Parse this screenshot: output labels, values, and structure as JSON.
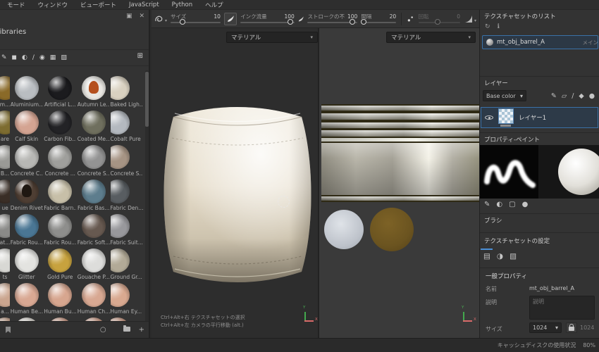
{
  "menubar": {
    "items": [
      {
        "label": "モード"
      },
      {
        "label": "ウィンドウ"
      },
      {
        "label": "ビューポート"
      },
      {
        "label": "JavaScript"
      },
      {
        "label": "Python"
      },
      {
        "label": "ヘルプ"
      }
    ]
  },
  "toolbar": {
    "size": {
      "label": "サイズ",
      "value": "10"
    },
    "flow": {
      "label": "インク流量",
      "value": "100"
    },
    "opacity": {
      "label": "ストロークの不",
      "value": "100"
    },
    "spacing": {
      "label": "間隔",
      "value": "20"
    },
    "rotation": {
      "label": "回転",
      "value": "0"
    }
  },
  "library": {
    "title": "Libraries",
    "filters": [
      {
        "name": "brush-filter-icon",
        "glyph": "✎"
      },
      {
        "name": "material-filter-icon",
        "glyph": "◼"
      },
      {
        "name": "smart-material-filter-icon",
        "glyph": "◐"
      },
      {
        "name": "pencil-filter-icon",
        "glyph": "∕"
      },
      {
        "name": "alpha-filter-icon",
        "glyph": "◉"
      },
      {
        "name": "pattern-filter-icon",
        "glyph": "▦"
      },
      {
        "name": "texture-filter-icon",
        "glyph": "▨"
      }
    ],
    "items": [
      {
        "name": "m...",
        "c": "#8a6a28"
      },
      {
        "name": "Aluminium...",
        "c": "#b9bdc1"
      },
      {
        "name": "Artificial L...",
        "c": "#1b1b1e"
      },
      {
        "name": "Autumn Le...",
        "c": "#e9e7e2",
        "accent": "#b5501e"
      },
      {
        "name": "Baked Ligh...",
        "c": "#d9d1c0"
      },
      {
        "name": "are",
        "c": "#7d6c30"
      },
      {
        "name": "Calf Skin",
        "c": "#d4a492"
      },
      {
        "name": "Carbon Fib...",
        "c": "#232326"
      },
      {
        "name": "Coated Me...",
        "c": "#6f6f5e"
      },
      {
        "name": "Cobalt Pure",
        "c": "#b4b9bf"
      },
      {
        "name": "B...",
        "c": "#9a9a96"
      },
      {
        "name": "Concrete C...",
        "c": "#b7b7b4"
      },
      {
        "name": "Concrete ...",
        "c": "#9f9f9c"
      },
      {
        "name": "Concrete S...",
        "c": "#939393"
      },
      {
        "name": "Concrete S...",
        "c": "#a69484"
      },
      {
        "name": "ue",
        "c": "#3a2e26"
      },
      {
        "name": "Denim Rivet",
        "c": "#4e3e33",
        "accent": "#1f1812"
      },
      {
        "name": "Fabric Barn...",
        "c": "#c7bfa8"
      },
      {
        "name": "Fabric Bas...",
        "c": "#5d7d8d"
      },
      {
        "name": "Fabric Den...",
        "c": "#585d61"
      },
      {
        "name": "at...",
        "c": "#8a8a88"
      },
      {
        "name": "Fabric Rou...",
        "c": "#4a7694"
      },
      {
        "name": "Fabric Rou...",
        "c": "#8e8e8c"
      },
      {
        "name": "Fabric Soft...",
        "c": "#675950"
      },
      {
        "name": "Fabric Suit...",
        "c": "#98989c"
      },
      {
        "name": "ts",
        "c": "#d8d8d4"
      },
      {
        "name": "Glitter",
        "c": "#e3e3e0"
      },
      {
        "name": "Gold Pure",
        "c": "#c7a23e"
      },
      {
        "name": "Gouache P...",
        "c": "#dddddb"
      },
      {
        "name": "Ground Gr...",
        "c": "#b2aa97"
      },
      {
        "name": "a...",
        "c": "#caa58e"
      },
      {
        "name": "Human Be...",
        "c": "#d9a893"
      },
      {
        "name": "Human Bu...",
        "c": "#d7a68f"
      },
      {
        "name": "Human Ch...",
        "c": "#d8a892"
      },
      {
        "name": "Human Ey...",
        "c": "#d9a990"
      },
      {
        "name": "",
        "c": "#caa58e"
      },
      {
        "name": "",
        "c": "#e8e4de",
        "accent": "#6a4a2a"
      },
      {
        "name": "",
        "c": "#d8a792"
      },
      {
        "name": "",
        "c": "#d8a792"
      },
      {
        "name": "",
        "c": "#d8a792"
      }
    ]
  },
  "viewport3d": {
    "mode": "マテリアル",
    "hint1": "Ctrl+Alt+右 テクスチャセットの選択",
    "hint2": "Ctrl+Alt+左 カメラの平行移動 (alt.)",
    "axis_y": "Y",
    "axis_x": "X"
  },
  "viewport2d": {
    "mode": "マテリアル",
    "axis_y": "Y",
    "axis_x": "X"
  },
  "right_panel": {
    "texture_set_list": {
      "title": "テクスチャセットのリスト",
      "item_name": "mt_obj_barrel_A",
      "item_tag": "メイン"
    },
    "layers": {
      "title": "レイヤー",
      "channel": "Base color",
      "layer_name": "レイヤー1",
      "tools": [
        {
          "name": "paint-tool-icon",
          "glyph": "✎"
        },
        {
          "name": "projection-tool-icon",
          "glyph": "▱"
        },
        {
          "name": "line-tool-icon",
          "glyph": "∕"
        },
        {
          "name": "fill-tool-icon",
          "glyph": "◆"
        },
        {
          "name": "eraser-tool-icon",
          "glyph": "●"
        }
      ]
    },
    "properties": {
      "title": "プロパティ-ペイント",
      "brush_section": "ブラシ",
      "subtools": [
        {
          "name": "brush-properties-icon",
          "glyph": "✎"
        },
        {
          "name": "material-properties-icon",
          "glyph": "◐"
        },
        {
          "name": "stencil-properties-icon",
          "glyph": "▢"
        },
        {
          "name": "eraser-properties-icon",
          "glyph": "●"
        }
      ]
    },
    "settings": {
      "title": "テクスチャセットの設定",
      "tabs": [
        {
          "name": "settings-general-tab-icon",
          "glyph": "▤"
        },
        {
          "name": "settings-channels-tab-icon",
          "glyph": "◑"
        },
        {
          "name": "settings-mesh-tab-icon",
          "glyph": "▧"
        }
      ],
      "general_title": "一般プロパティ",
      "name_label": "名前",
      "name_value": "mt_obj_barrel_A",
      "desc_label": "説明",
      "desc_placeholder": "説明",
      "size_label": "サイズ",
      "size_value": "1024",
      "size_value_locked": "1024"
    }
  },
  "statusbar": {
    "label": "キャッシュディスクの使用状況",
    "value": "80%"
  },
  "icons": {
    "chevron": "▾",
    "close": "✕",
    "dock": "▣",
    "grid_view": "⊞",
    "refresh": "○",
    "add": "+",
    "sync": "↻",
    "info": "ℹ"
  }
}
